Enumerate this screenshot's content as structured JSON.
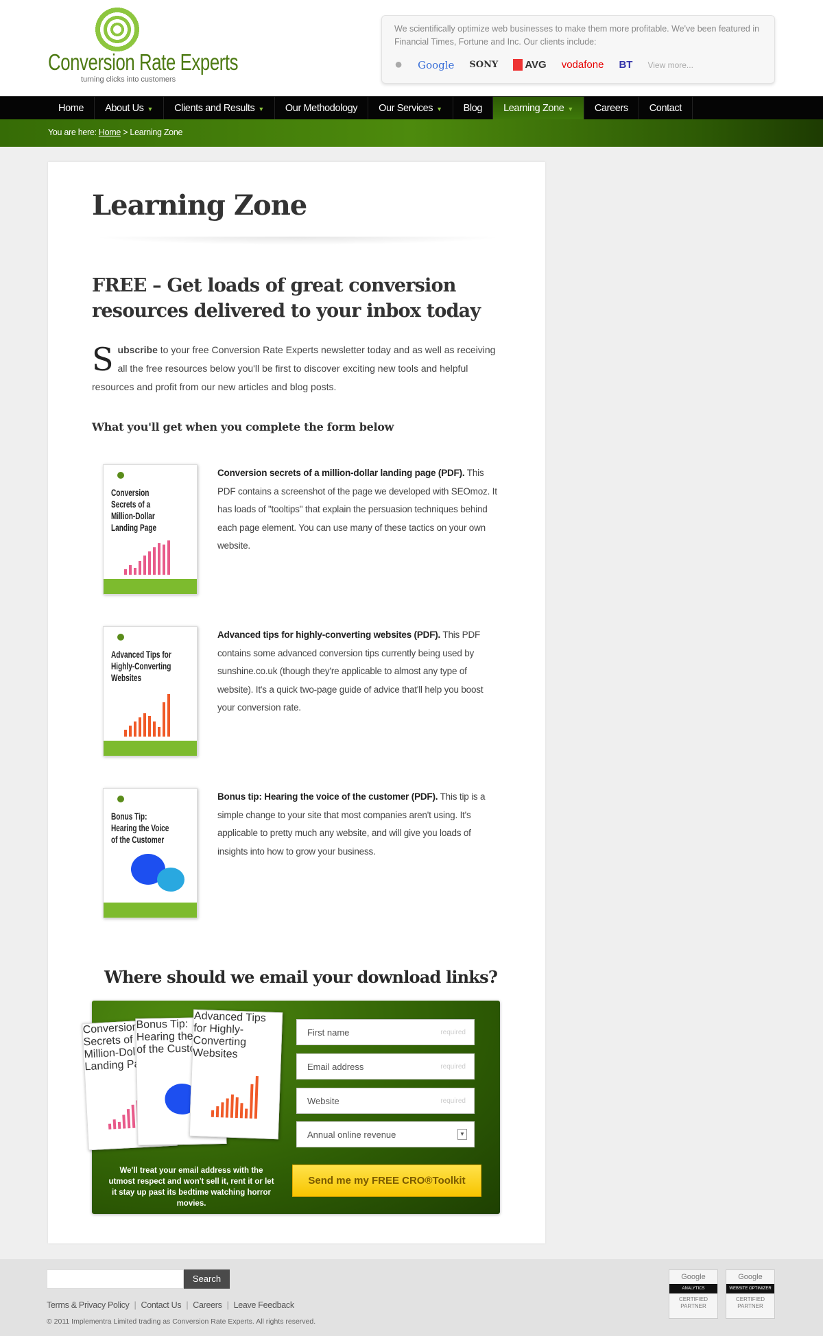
{
  "brand": {
    "name": "Conversion Rate Experts",
    "tagline": "turning clicks into customers",
    "accent": "#4d8a0d"
  },
  "clients": {
    "text": "We scientifically optimize web businesses to make them more profitable. We've been featured in Financial Times, Fortune and Inc. Our clients include:",
    "logos": [
      "Apple",
      "Google",
      "SONY",
      "AVG",
      "vodafone",
      "BT"
    ],
    "view_more": "View more..."
  },
  "nav": {
    "items": [
      {
        "label": "Home"
      },
      {
        "label": "About Us",
        "dropdown": true
      },
      {
        "label": "Clients and Results",
        "dropdown": true
      },
      {
        "label": "Our Methodology"
      },
      {
        "label": "Our Services",
        "dropdown": true
      },
      {
        "label": "Blog"
      },
      {
        "label": "Learning Zone",
        "dropdown": true,
        "active": true
      },
      {
        "label": "Careers"
      },
      {
        "label": "Contact"
      }
    ]
  },
  "breadcrumb": {
    "prefix": "You are here:",
    "home": "Home",
    "sep": ">",
    "current": "Learning Zone"
  },
  "main": {
    "title": "Learning Zone",
    "subtitle": "FREE – Get loads of great conversion resources delivered to your inbox today",
    "intro_dropcap": "S",
    "intro_bold": "ubscribe",
    "intro_rest": " to your free Conversion Rate Experts newsletter today and as well as receiving all the free resources below you'll be first to discover exciting new tools and helpful resources and profit from our new articles and blog posts.",
    "what_heading": "What you'll get when you complete the form below",
    "resources": [
      {
        "thumb_title": "Conversion Secrets of a Million-Dollar Landing Page",
        "title": "Conversion secrets of a million-dollar landing page (PDF).",
        "text": " This PDF contains a screenshot of the page we developed with SEOmoz. It has loads of \"tooltips\" that explain the persuasion techniques behind each page element. You can use many of these tactics on your own website."
      },
      {
        "thumb_title": "Advanced Tips for Highly-Converting Websites",
        "title": "Advanced tips for highly-converting websites (PDF).",
        "text": " This PDF contains some advanced conversion tips currently being used by sunshine.co.uk (though they're applicable to almost any type of website). It's a quick two-page guide of advice that'll help you boost your conversion rate."
      },
      {
        "thumb_title": "Bonus Tip: Hearing the Voice of the Customer",
        "title": "Bonus tip: Hearing the voice of the customer (PDF).",
        "text": " This tip is a simple change to your site that most companies aren't using. It's applicable to pretty much any website, and will give you loads of insights into how to grow your business."
      }
    ]
  },
  "form": {
    "heading": "Where should we email your download links?",
    "first_name": "First name",
    "email": "Email address",
    "website": "Website",
    "required": "required",
    "revenue": "Annual online revenue",
    "submit": "Send me my FREE CRO®Toolkit",
    "privacy": "We'll treat your email address with the utmost respect and won't sell it, rent it or let it stay up past its bedtime watching horror movies."
  },
  "footer": {
    "search_button": "Search",
    "links": [
      "Terms & Privacy Policy",
      "Contact Us",
      "Careers",
      "Leave Feedback"
    ],
    "copyright": "© 2011 Implementra Limited trading as Conversion Rate Experts. All rights reserved.",
    "badges": [
      {
        "brand": "Google",
        "product": "ANALYTICS",
        "status": "CERTIFIED PARTNER"
      },
      {
        "brand": "Google",
        "product": "WEBSITE OPTIMIZER",
        "status": "CERTIFIED PARTNER"
      }
    ]
  }
}
